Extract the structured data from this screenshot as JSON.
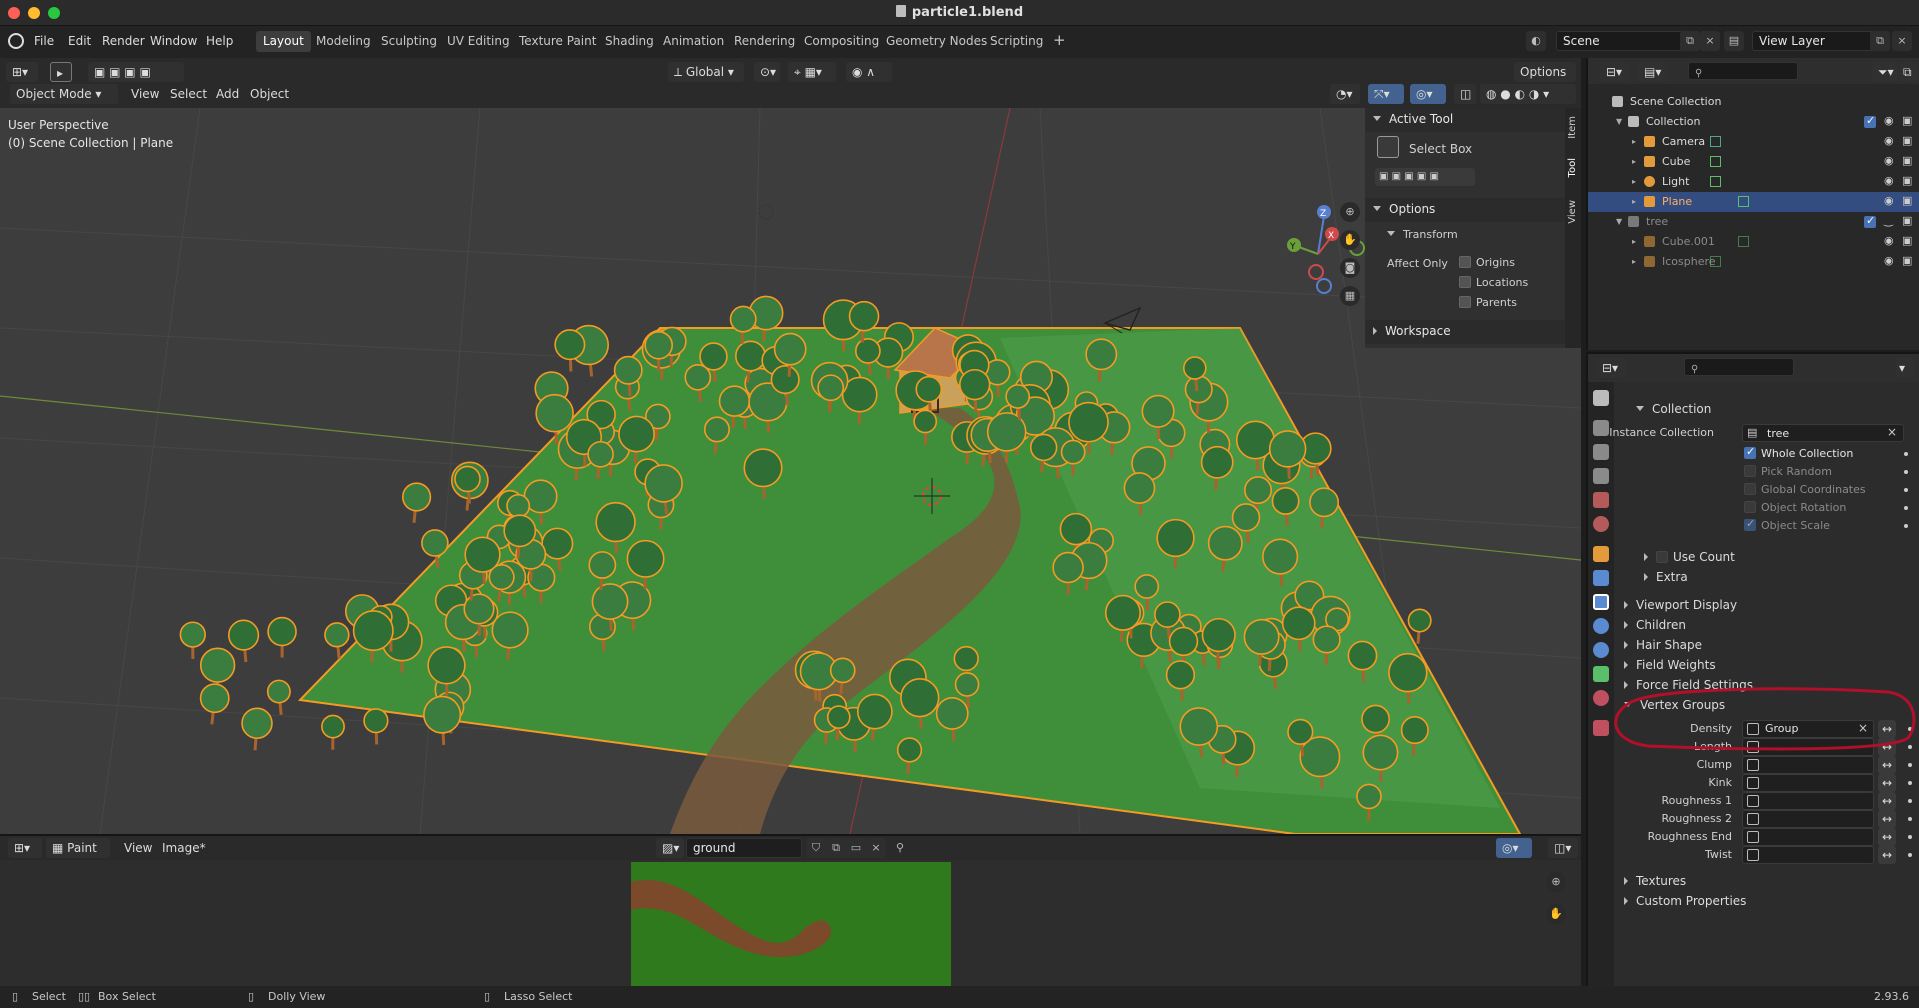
{
  "window": {
    "title": "particle1.blend"
  },
  "menu": {
    "items": [
      "File",
      "Edit",
      "Render",
      "Window",
      "Help"
    ]
  },
  "workspaces": [
    "Layout",
    "Modeling",
    "Sculpting",
    "UV Editing",
    "Texture Paint",
    "Shading",
    "Animation",
    "Rendering",
    "Compositing",
    "Geometry Nodes",
    "Scripting"
  ],
  "active_workspace": "Layout",
  "scene": {
    "name": "Scene",
    "view_layer": "View Layer"
  },
  "viewport": {
    "mode": "Object Mode",
    "menus": [
      "View",
      "Select",
      "Add",
      "Object"
    ],
    "orientation": "Global",
    "options_label": "Options",
    "info_line1": "User Perspective",
    "info_line2": "(0) Scene Collection | Plane",
    "gizmo": {
      "x": "X",
      "y": "Y",
      "z": "Z"
    }
  },
  "npanel": {
    "active_tool_header": "Active Tool",
    "tool_name": "Select Box",
    "options_header": "Options",
    "transform_header": "Transform",
    "affect_only": "Affect Only",
    "checks": [
      "Origins",
      "Locations",
      "Parents"
    ],
    "workspace_header": "Workspace",
    "tabs": [
      "Item",
      "Tool",
      "View"
    ]
  },
  "image_editor": {
    "mode": "Paint",
    "menus": [
      "View",
      "Image*"
    ],
    "image_name": "ground"
  },
  "statusbar": {
    "items": [
      "Select",
      "Box Select",
      "Dolly View",
      "Lasso Select"
    ],
    "version": "2.93.6"
  },
  "outliner": {
    "rows": [
      {
        "label": "Scene Collection",
        "indent": 0,
        "selected": false,
        "dim": false,
        "type": "scene"
      },
      {
        "label": "Collection",
        "indent": 1,
        "selected": false,
        "dim": false,
        "type": "collection"
      },
      {
        "label": "Camera",
        "indent": 2,
        "selected": false,
        "dim": false,
        "type": "camera"
      },
      {
        "label": "Cube",
        "indent": 2,
        "selected": false,
        "dim": false,
        "type": "mesh"
      },
      {
        "label": "Light",
        "indent": 2,
        "selected": false,
        "dim": false,
        "type": "light"
      },
      {
        "label": "Plane",
        "indent": 2,
        "selected": true,
        "dim": false,
        "type": "mesh"
      },
      {
        "label": "tree",
        "indent": 1,
        "selected": false,
        "dim": true,
        "type": "collection"
      },
      {
        "label": "Cube.001",
        "indent": 2,
        "selected": false,
        "dim": true,
        "type": "mesh"
      },
      {
        "label": "Icosphere",
        "indent": 2,
        "selected": false,
        "dim": true,
        "type": "mesh"
      }
    ]
  },
  "properties": {
    "collection_header": "Collection",
    "instance_collection_label": "Instance Collection",
    "instance_collection_value": "tree",
    "checks": [
      {
        "label": "Whole Collection",
        "checked": true,
        "dim": false
      },
      {
        "label": "Pick Random",
        "checked": false,
        "dim": true
      },
      {
        "label": "Global Coordinates",
        "checked": false,
        "dim": true
      },
      {
        "label": "Object Rotation",
        "checked": false,
        "dim": true
      },
      {
        "label": "Object Scale",
        "checked": true,
        "dim": true
      }
    ],
    "use_count": "Use Count",
    "extra": "Extra",
    "sections": [
      "Viewport Display",
      "Children",
      "Hair Shape",
      "Field Weights",
      "Force Field Settings"
    ],
    "vertex_groups_header": "Vertex Groups",
    "vertex_groups": [
      {
        "label": "Density",
        "value": "Group"
      },
      {
        "label": "Length",
        "value": ""
      },
      {
        "label": "Clump",
        "value": ""
      },
      {
        "label": "Kink",
        "value": ""
      },
      {
        "label": "Roughness 1",
        "value": ""
      },
      {
        "label": "Roughness 2",
        "value": ""
      },
      {
        "label": "Roughness End",
        "value": ""
      },
      {
        "label": "Twist",
        "value": ""
      }
    ],
    "bottom_sections": [
      "Textures",
      "Custom Properties"
    ]
  },
  "colors": {
    "accent": "#4772b3",
    "highlight_ring": "#b0102a",
    "selection_orange": "#f59a23",
    "ground_green": "#3f8f3a",
    "path_brown": "#7a5a3e",
    "tree_green": "#2f6f35"
  }
}
